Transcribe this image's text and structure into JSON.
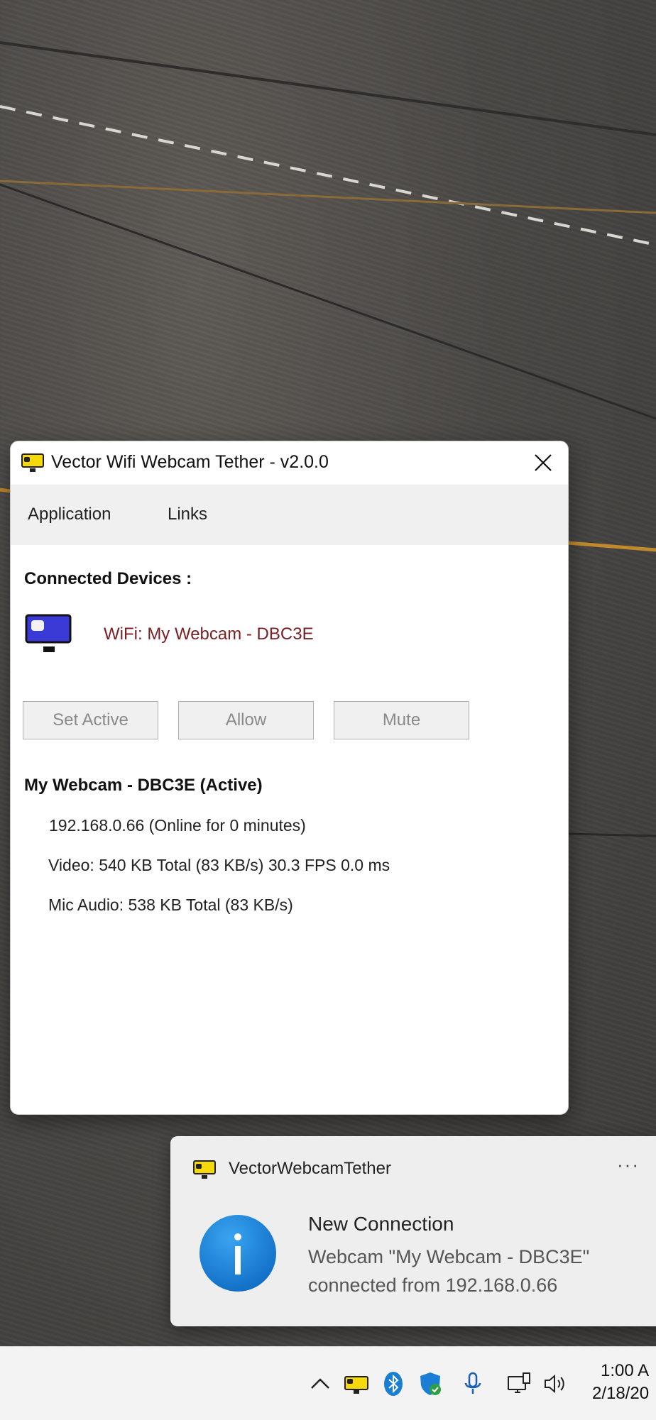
{
  "window": {
    "title": "Vector Wifi Webcam Tether - v2.0.0"
  },
  "menu": {
    "items": [
      "Application",
      "Links"
    ]
  },
  "devices": {
    "heading": "Connected Devices :",
    "items": [
      {
        "label": "WiFi: My Webcam - DBC3E",
        "icon": "webcam-device-icon"
      }
    ]
  },
  "buttons": {
    "set_active": "Set Active",
    "allow": "Allow",
    "mute": "Mute"
  },
  "details": {
    "heading": "My Webcam - DBC3E (Active)",
    "ip_line": "192.168.0.66 (Online for 0 minutes)",
    "video_line": "Video: 540 KB Total (83 KB/s)  30.3 FPS  0.0 ms",
    "audio_line": "Mic Audio: 538 KB Total (83 KB/s)"
  },
  "toast": {
    "app_name": "VectorWebcamTether",
    "more": "···",
    "title": "New Connection",
    "body_line1": "Webcam \"My Webcam - DBC3E\"",
    "body_line2": "connected from 192.168.0.66"
  },
  "taskbar": {
    "tray_icons": [
      "chevron-up-icon",
      "webcam-tether-icon",
      "bluetooth-icon",
      "defender-shield-icon",
      "microphone-icon",
      "network-icon",
      "volume-icon"
    ],
    "time": "1:00 A",
    "date": "2/18/20"
  },
  "colors": {
    "device_label": "#7a1f23",
    "info_blue": "#1a7fd4",
    "app_icon_yellow": "#f5d90a"
  }
}
